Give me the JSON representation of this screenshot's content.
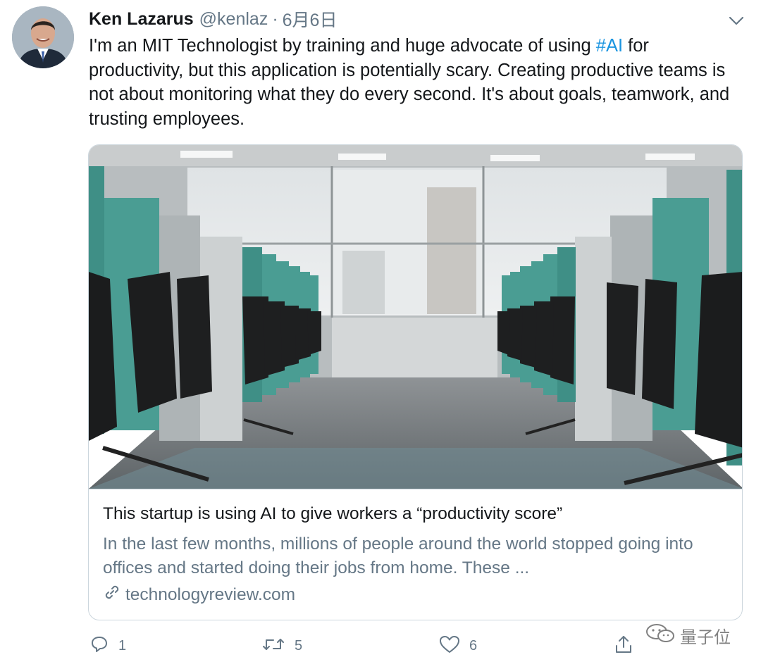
{
  "tweet": {
    "author_name": "Ken Lazarus",
    "author_handle": "@kenlaz",
    "separator": "·",
    "date": "6月6日",
    "text_before_hashtag": "I'm an MIT Technologist by training and huge advocate of using ",
    "hashtag": "#AI",
    "text_after_hashtag": " for productivity, but this application is potentially scary. Creating productive teams is not about monitoring what they do every second. It's about goals, teamwork, and trusting employees."
  },
  "card": {
    "title": "This startup is using AI to give workers a “productivity score”",
    "description": "In the last few months, millions of people around the world stopped going into offices and started doing their jobs from home. These ...",
    "domain": "technologyreview.com"
  },
  "actions": {
    "reply_count": "1",
    "retweet_count": "5",
    "like_count": "6"
  },
  "watermark": {
    "text": "量子位"
  },
  "icons": {
    "menu": "chevron-down-icon",
    "link": "link-icon",
    "reply": "reply-icon",
    "retweet": "retweet-icon",
    "like": "heart-icon",
    "share": "share-icon"
  },
  "colors": {
    "hashtag": "#1b95e0",
    "secondary_text": "#657786",
    "border": "#ccd6dd"
  }
}
